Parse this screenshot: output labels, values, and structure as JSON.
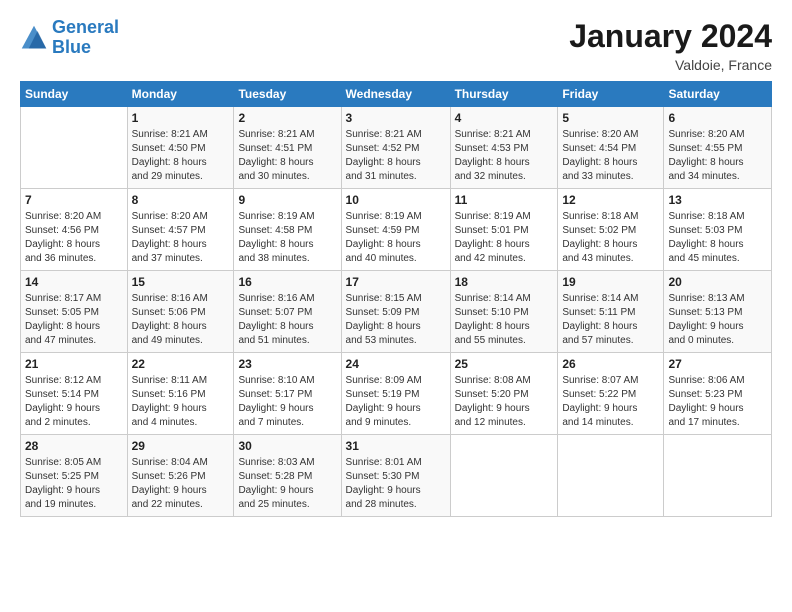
{
  "header": {
    "logo_line1": "General",
    "logo_line2": "Blue",
    "month_title": "January 2024",
    "location": "Valdoie, France"
  },
  "days_of_week": [
    "Sunday",
    "Monday",
    "Tuesday",
    "Wednesday",
    "Thursday",
    "Friday",
    "Saturday"
  ],
  "weeks": [
    [
      {
        "num": "",
        "info": ""
      },
      {
        "num": "1",
        "info": "Sunrise: 8:21 AM\nSunset: 4:50 PM\nDaylight: 8 hours\nand 29 minutes."
      },
      {
        "num": "2",
        "info": "Sunrise: 8:21 AM\nSunset: 4:51 PM\nDaylight: 8 hours\nand 30 minutes."
      },
      {
        "num": "3",
        "info": "Sunrise: 8:21 AM\nSunset: 4:52 PM\nDaylight: 8 hours\nand 31 minutes."
      },
      {
        "num": "4",
        "info": "Sunrise: 8:21 AM\nSunset: 4:53 PM\nDaylight: 8 hours\nand 32 minutes."
      },
      {
        "num": "5",
        "info": "Sunrise: 8:20 AM\nSunset: 4:54 PM\nDaylight: 8 hours\nand 33 minutes."
      },
      {
        "num": "6",
        "info": "Sunrise: 8:20 AM\nSunset: 4:55 PM\nDaylight: 8 hours\nand 34 minutes."
      }
    ],
    [
      {
        "num": "7",
        "info": "Sunrise: 8:20 AM\nSunset: 4:56 PM\nDaylight: 8 hours\nand 36 minutes."
      },
      {
        "num": "8",
        "info": "Sunrise: 8:20 AM\nSunset: 4:57 PM\nDaylight: 8 hours\nand 37 minutes."
      },
      {
        "num": "9",
        "info": "Sunrise: 8:19 AM\nSunset: 4:58 PM\nDaylight: 8 hours\nand 38 minutes."
      },
      {
        "num": "10",
        "info": "Sunrise: 8:19 AM\nSunset: 4:59 PM\nDaylight: 8 hours\nand 40 minutes."
      },
      {
        "num": "11",
        "info": "Sunrise: 8:19 AM\nSunset: 5:01 PM\nDaylight: 8 hours\nand 42 minutes."
      },
      {
        "num": "12",
        "info": "Sunrise: 8:18 AM\nSunset: 5:02 PM\nDaylight: 8 hours\nand 43 minutes."
      },
      {
        "num": "13",
        "info": "Sunrise: 8:18 AM\nSunset: 5:03 PM\nDaylight: 8 hours\nand 45 minutes."
      }
    ],
    [
      {
        "num": "14",
        "info": "Sunrise: 8:17 AM\nSunset: 5:05 PM\nDaylight: 8 hours\nand 47 minutes."
      },
      {
        "num": "15",
        "info": "Sunrise: 8:16 AM\nSunset: 5:06 PM\nDaylight: 8 hours\nand 49 minutes."
      },
      {
        "num": "16",
        "info": "Sunrise: 8:16 AM\nSunset: 5:07 PM\nDaylight: 8 hours\nand 51 minutes."
      },
      {
        "num": "17",
        "info": "Sunrise: 8:15 AM\nSunset: 5:09 PM\nDaylight: 8 hours\nand 53 minutes."
      },
      {
        "num": "18",
        "info": "Sunrise: 8:14 AM\nSunset: 5:10 PM\nDaylight: 8 hours\nand 55 minutes."
      },
      {
        "num": "19",
        "info": "Sunrise: 8:14 AM\nSunset: 5:11 PM\nDaylight: 8 hours\nand 57 minutes."
      },
      {
        "num": "20",
        "info": "Sunrise: 8:13 AM\nSunset: 5:13 PM\nDaylight: 9 hours\nand 0 minutes."
      }
    ],
    [
      {
        "num": "21",
        "info": "Sunrise: 8:12 AM\nSunset: 5:14 PM\nDaylight: 9 hours\nand 2 minutes."
      },
      {
        "num": "22",
        "info": "Sunrise: 8:11 AM\nSunset: 5:16 PM\nDaylight: 9 hours\nand 4 minutes."
      },
      {
        "num": "23",
        "info": "Sunrise: 8:10 AM\nSunset: 5:17 PM\nDaylight: 9 hours\nand 7 minutes."
      },
      {
        "num": "24",
        "info": "Sunrise: 8:09 AM\nSunset: 5:19 PM\nDaylight: 9 hours\nand 9 minutes."
      },
      {
        "num": "25",
        "info": "Sunrise: 8:08 AM\nSunset: 5:20 PM\nDaylight: 9 hours\nand 12 minutes."
      },
      {
        "num": "26",
        "info": "Sunrise: 8:07 AM\nSunset: 5:22 PM\nDaylight: 9 hours\nand 14 minutes."
      },
      {
        "num": "27",
        "info": "Sunrise: 8:06 AM\nSunset: 5:23 PM\nDaylight: 9 hours\nand 17 minutes."
      }
    ],
    [
      {
        "num": "28",
        "info": "Sunrise: 8:05 AM\nSunset: 5:25 PM\nDaylight: 9 hours\nand 19 minutes."
      },
      {
        "num": "29",
        "info": "Sunrise: 8:04 AM\nSunset: 5:26 PM\nDaylight: 9 hours\nand 22 minutes."
      },
      {
        "num": "30",
        "info": "Sunrise: 8:03 AM\nSunset: 5:28 PM\nDaylight: 9 hours\nand 25 minutes."
      },
      {
        "num": "31",
        "info": "Sunrise: 8:01 AM\nSunset: 5:30 PM\nDaylight: 9 hours\nand 28 minutes."
      },
      {
        "num": "",
        "info": ""
      },
      {
        "num": "",
        "info": ""
      },
      {
        "num": "",
        "info": ""
      }
    ]
  ]
}
